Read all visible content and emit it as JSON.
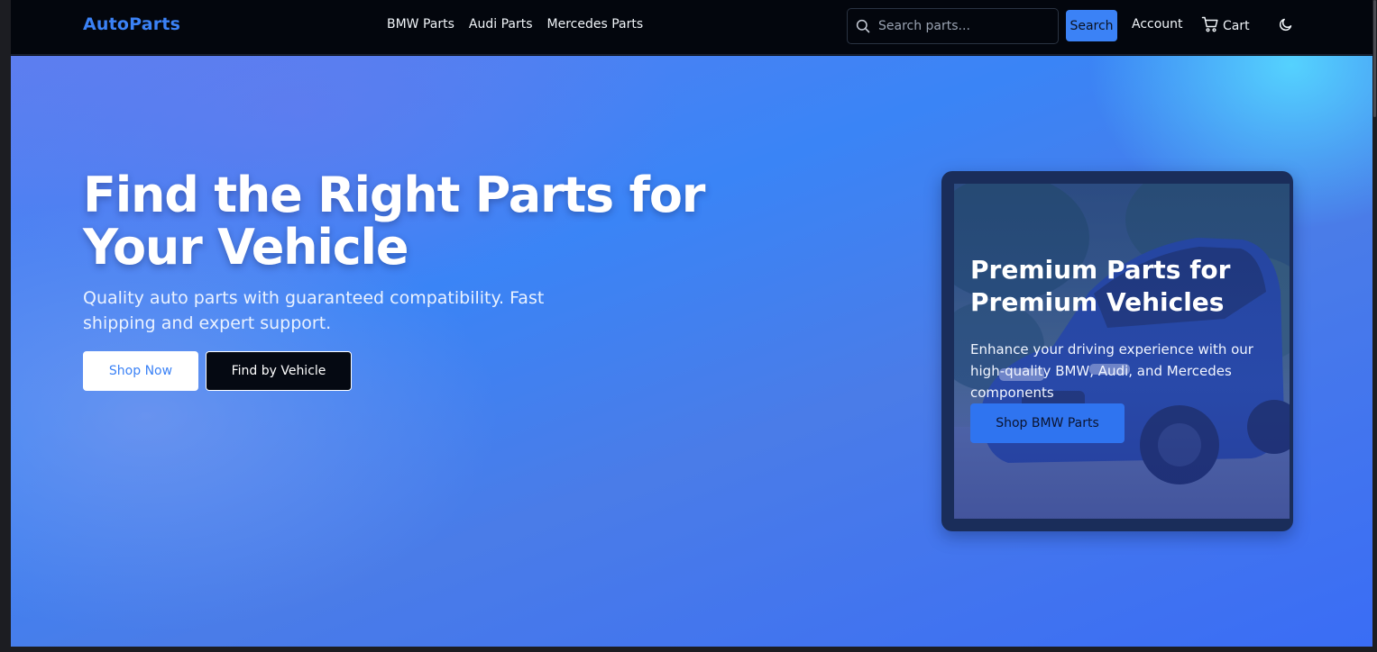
{
  "nav": {
    "brand": "AutoParts",
    "links": [
      "BMW Parts",
      "Audi Parts",
      "Mercedes Parts"
    ],
    "search_placeholder": "Search parts...",
    "search_button": "Search",
    "account": "Account",
    "cart": "Cart",
    "theme_toggle_icon": "moon-icon"
  },
  "hero": {
    "title": "Find the Right Parts for Your Vehicle",
    "subtitle": "Quality auto parts with guaranteed compatibility. Fast shipping and expert support.",
    "primary_button": "Shop Now",
    "secondary_button": "Find by Vehicle"
  },
  "promo": {
    "title": "Premium Parts for Premium Vehicles",
    "text": "Enhance your driving experience with our high-quality BMW, Audi, and Mercedes components",
    "button": "Shop BMW Parts",
    "image_icon": "car-photo"
  },
  "colors": {
    "brand": "#3b82f6",
    "nav_background": "#03060d",
    "hero_gradient_start": "#5b7ff0",
    "hero_gradient_end": "#3a6df5",
    "accent_cyan": "#56d6ff",
    "promo_button": "#2f74f0"
  }
}
